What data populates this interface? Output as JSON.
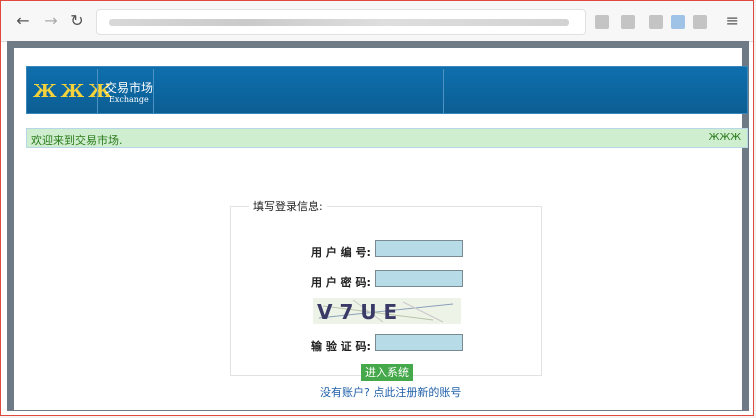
{
  "browser": {
    "back_icon": "←",
    "forward_icon": "→",
    "reload_icon": "↻",
    "menu_icon": "≡"
  },
  "header": {
    "logo_text": "ЖЖЖ",
    "title_cn": "交易市场",
    "title_en": "Exchange"
  },
  "welcome": {
    "text": "欢迎来到交易市场.",
    "icon_text": "ЖЖЖ"
  },
  "login": {
    "legend": "填写登录信息:",
    "username_label": "用 户 编 号:",
    "password_label": "用 户 密 码:",
    "captcha_text": "V 7 U E",
    "captcha_label": "输 验 证 码:",
    "submit_label": "进入系统",
    "username_value": "",
    "password_value": "",
    "captcha_value": ""
  },
  "register_link": "没有账户? 点此注册新的账号",
  "colors": {
    "banner": "#0b5e93",
    "welcome_bg": "#cfeecf",
    "input_bg": "#b8dbe8",
    "submit_bg": "#45a84a",
    "link": "#1f5fa8"
  }
}
